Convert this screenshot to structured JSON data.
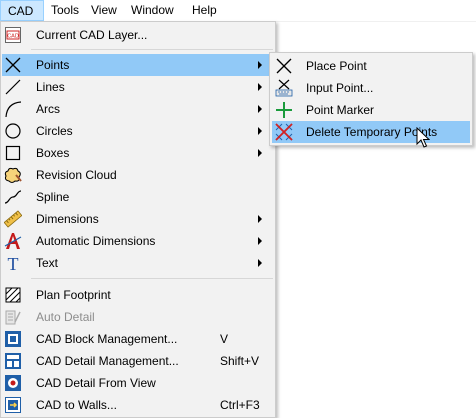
{
  "menubar": {
    "items": [
      {
        "label": "CAD",
        "active": true
      },
      {
        "label": "Tools"
      },
      {
        "label": "View"
      },
      {
        "label": "Window"
      },
      {
        "label": "Help"
      }
    ]
  },
  "cad_menu": {
    "items": [
      {
        "label": "Current CAD Layer...",
        "icon": "cad-layer-icon"
      },
      {
        "label": "Points",
        "icon": "points-x-icon",
        "submenu": true,
        "highlighted": true
      },
      {
        "label": "Lines",
        "icon": "line-icon",
        "submenu": true
      },
      {
        "label": "Arcs",
        "icon": "arc-icon",
        "submenu": true
      },
      {
        "label": "Circles",
        "icon": "circle-icon",
        "submenu": true
      },
      {
        "label": "Boxes",
        "icon": "box-icon",
        "submenu": true
      },
      {
        "label": "Revision Cloud",
        "icon": "revision-cloud-icon"
      },
      {
        "label": "Spline",
        "icon": "spline-icon"
      },
      {
        "label": "Dimensions",
        "icon": "dimension-ruler-icon",
        "submenu": true
      },
      {
        "label": "Automatic Dimensions",
        "icon": "auto-dimension-icon",
        "submenu": true
      },
      {
        "label": "Text",
        "icon": "text-icon",
        "submenu": true
      },
      {
        "label": "Plan Footprint",
        "icon": "plan-footprint-icon"
      },
      {
        "label": "Auto Detail",
        "icon": "auto-detail-icon",
        "disabled": true
      },
      {
        "label": "CAD Block Management...",
        "icon": "cad-block-icon",
        "shortcut": "V"
      },
      {
        "label": "CAD Detail Management...",
        "icon": "cad-detail-icon",
        "shortcut": "Shift+V"
      },
      {
        "label": "CAD Detail From View",
        "icon": "detail-from-view-icon"
      },
      {
        "label": "CAD to Walls...",
        "icon": "cad-to-walls-icon",
        "shortcut": "Ctrl+F3"
      }
    ]
  },
  "points_submenu": {
    "items": [
      {
        "label": "Place Point",
        "icon": "place-point-icon"
      },
      {
        "label": "Input Point...",
        "icon": "input-point-icon"
      },
      {
        "label": "Point Marker",
        "icon": "point-marker-icon"
      },
      {
        "label": "Delete Temporary Points",
        "icon": "delete-temp-points-icon",
        "highlighted": true
      }
    ]
  },
  "colors": {
    "highlight": "#91c9f7",
    "menu_bg": "#f2f2f2",
    "active_top": "#cce8ff",
    "marker_green": "#1a9b3c",
    "delete_red": "#d22222",
    "icon_blue": "#1f5fa8"
  }
}
